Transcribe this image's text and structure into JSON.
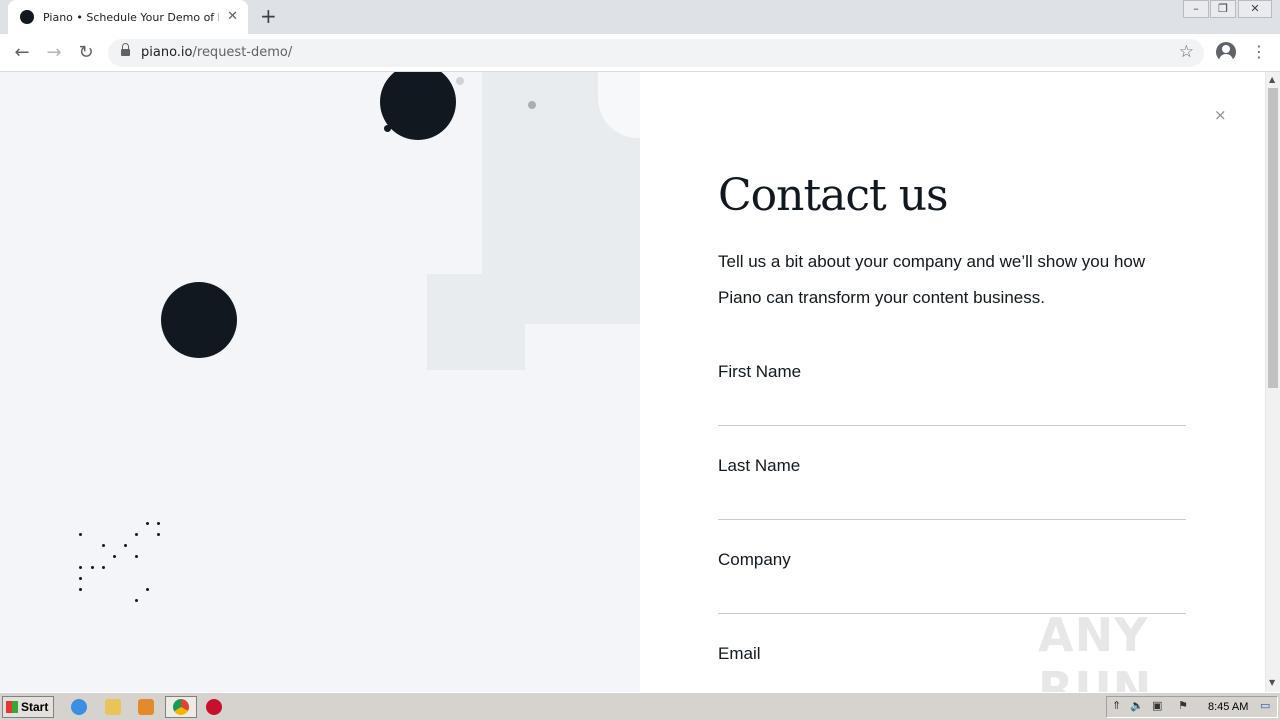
{
  "browser": {
    "tab_title": "Piano • Schedule Your Demo of Piano",
    "tab_close_icon": "close-icon",
    "new_tab_symbol": "+",
    "url_host": "piano.io",
    "url_path": "/request-demo/",
    "window_controls": [
      "–",
      "❐",
      "✕"
    ]
  },
  "page": {
    "heading": "Contact us",
    "lead": "Tell us a bit about your company and we’ll show you how Piano can transform your content business.",
    "close_symbol": "×",
    "fields": [
      {
        "label": "First Name",
        "value": ""
      },
      {
        "label": "Last Name",
        "value": ""
      },
      {
        "label": "Company",
        "value": ""
      },
      {
        "label": "Email",
        "value": ""
      }
    ],
    "watermark": "ANY RUN"
  },
  "taskbar": {
    "start_label": "Start",
    "clock": "8:45 AM"
  },
  "colors": {
    "ink": "#111820",
    "left_panel_bg": "#f3f5f8",
    "tab_bar": "#dee1e6"
  }
}
